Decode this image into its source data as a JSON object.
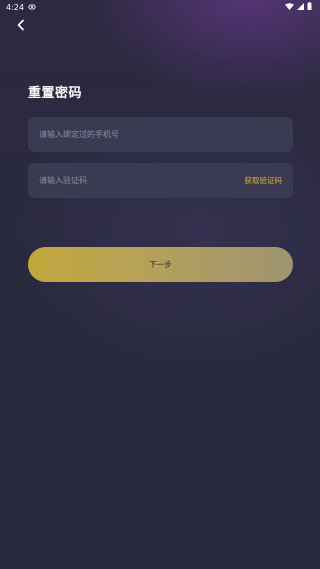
{
  "status_bar": {
    "time": "4:24"
  },
  "page": {
    "title": "重置密码"
  },
  "form": {
    "phone_placeholder": "请输入绑定过的手机号",
    "code_placeholder": "请输入验证码",
    "get_code_label": "获取验证码",
    "next_label": "下一步"
  },
  "colors": {
    "accent": "#e0b23b",
    "button_start": "#c3a73c",
    "button_end": "#9e9470",
    "field_bg": "#3a3b53",
    "background": "#2a2a3f"
  }
}
